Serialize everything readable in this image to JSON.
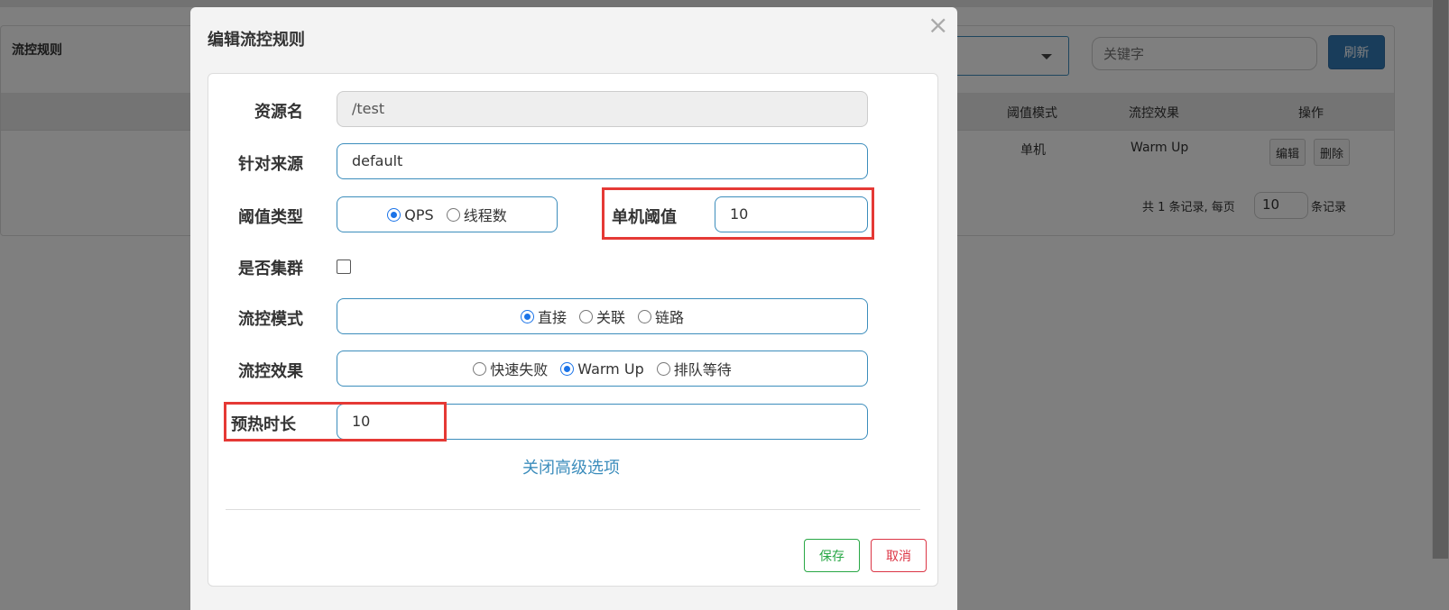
{
  "background": {
    "panel_title": "流控规则",
    "search_placeholder": "关键字",
    "refresh_label": "刷新",
    "columns": [
      "阈值模式",
      "流控效果",
      "操作"
    ],
    "row": {
      "threshold_mode": "单机",
      "effect": "Warm Up",
      "edit_label": "编辑",
      "delete_label": "删除"
    },
    "pager": {
      "total_text": "共 1 条记录, 每页",
      "page_size": "10",
      "suffix": "条记录"
    }
  },
  "modal": {
    "title": "编辑流控规则",
    "close_glyph": "×",
    "resource": {
      "label": "资源名",
      "value": "/test"
    },
    "origin": {
      "label": "针对来源",
      "value": "default"
    },
    "threshold_type": {
      "label": "阈值类型",
      "options": [
        "QPS",
        "线程数"
      ],
      "selected": "QPS"
    },
    "single_threshold": {
      "label": "单机阈值",
      "value": "10"
    },
    "cluster": {
      "label": "是否集群",
      "checked": false
    },
    "flow_mode": {
      "label": "流控模式",
      "options": [
        "直接",
        "关联",
        "链路"
      ],
      "selected": "直接"
    },
    "flow_effect": {
      "label": "流控效果",
      "options": [
        "快速失败",
        "Warm Up",
        "排队等待"
      ],
      "selected": "Warm Up"
    },
    "warmup": {
      "label": "预热时长",
      "value": "10"
    },
    "advanced_link": "关闭高级选项",
    "save_label": "保存",
    "cancel_label": "取消"
  },
  "colors": {
    "accent": "#3c8dbc",
    "highlight": "#e53935",
    "save": "#28a745",
    "cancel": "#dc3545"
  }
}
